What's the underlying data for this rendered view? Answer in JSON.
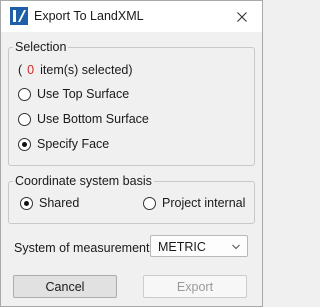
{
  "window": {
    "title": "Export To LandXML",
    "app_icon": "landxml-app-icon",
    "close_icon": "close-icon"
  },
  "selection": {
    "group_title": "Selection",
    "count_open_paren": "(",
    "count": "0",
    "count_suffix": "item(s) selected)",
    "options": [
      {
        "label": "Use Top Surface",
        "checked": false
      },
      {
        "label": "Use Bottom Surface",
        "checked": false
      },
      {
        "label": "Specify Face",
        "checked": true
      }
    ]
  },
  "coordinate_system": {
    "group_title": "Coordinate system basis",
    "options": [
      {
        "label": "Shared",
        "checked": true
      },
      {
        "label": "Project internal",
        "checked": false
      }
    ]
  },
  "measurement": {
    "label": "System of measurement",
    "selected": "METRIC"
  },
  "buttons": {
    "cancel": "Cancel",
    "export": "Export",
    "export_enabled": false
  },
  "colors": {
    "count_highlight": "#d62828",
    "app_icon_blue": "#1f5fa8"
  }
}
